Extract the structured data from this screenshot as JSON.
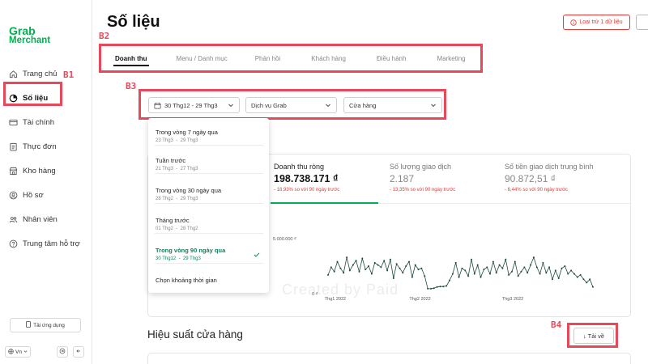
{
  "app": {
    "logo_line1": "Grab",
    "logo_line2": "Merchant",
    "brand_color": "#00b14f",
    "annotation_color": "#e8495a"
  },
  "sidebar": {
    "items": [
      {
        "label": "Trang chủ",
        "icon": "home-icon",
        "active": false
      },
      {
        "label": "Số liệu",
        "icon": "pie-chart-icon",
        "active": true
      },
      {
        "label": "Tài chính",
        "icon": "card-icon",
        "active": false
      },
      {
        "label": "Thực đơn",
        "icon": "clipboard-icon",
        "active": false
      },
      {
        "label": "Kho hàng",
        "icon": "store-icon",
        "active": false
      },
      {
        "label": "Hồ sơ",
        "icon": "profile-icon",
        "active": false
      },
      {
        "label": "Nhân viên",
        "icon": "staff-icon",
        "active": false
      },
      {
        "label": "Trung tâm hỗ trợ",
        "icon": "help-icon",
        "active": false
      }
    ],
    "download_app_label": "Tải ứng dụng",
    "language_label": "Vn"
  },
  "header": {
    "title": "Số liệu",
    "exclude_label": "Loại trừ 1 dữ liệu"
  },
  "tabs": [
    {
      "label": "Doanh thu",
      "active": true
    },
    {
      "label": "Menu / Danh mục",
      "active": false
    },
    {
      "label": "Phản hồi",
      "active": false
    },
    {
      "label": "Khách hàng",
      "active": false
    },
    {
      "label": "Điều hành",
      "active": false
    },
    {
      "label": "Marketing",
      "active": false
    }
  ],
  "annotations": {
    "b1": "B1",
    "b2": "B2",
    "b3": "B3",
    "b4": "B4"
  },
  "filters": {
    "date_range": "30 Thg12 - 29 Thg3",
    "service": "Dịch vụ Grab",
    "store": "Cửa hàng"
  },
  "date_dropdown": {
    "options": [
      {
        "label": "Trong vòng 7 ngày qua",
        "from": "23 Thg3",
        "to": "29 Thg3",
        "selected": false
      },
      {
        "label": "Tuần trước",
        "from": "21 Thg3",
        "to": "27 Thg3",
        "selected": false
      },
      {
        "label": "Trong vòng 30 ngày qua",
        "from": "28 Thg2",
        "to": "29 Thg3",
        "selected": false
      },
      {
        "label": "Tháng trước",
        "from": "01 Thg2",
        "to": "28 Thg2",
        "selected": false
      },
      {
        "label": "Trong vòng 90 ngày qua",
        "from": "30 Thg12",
        "to": "29 Thg3",
        "selected": true
      },
      {
        "label": "Chọn khoảng thời gian",
        "from": "",
        "to": "",
        "selected": false
      }
    ],
    "range_separator": "-"
  },
  "stats": [
    {
      "label": "Doanh thu ròng",
      "value": "198.738.171 ₫",
      "change": "- 18,93% so với 90 ngày trước"
    },
    {
      "label": "Số lượng giao dịch",
      "value": "2.187",
      "change": "- 13,35% so với 90 ngày trước"
    },
    {
      "label": "Số tiền giao dịch trung bình",
      "value": "90.872,51 ₫",
      "change": "- 6,44% so với 90 ngày trước"
    }
  ],
  "chart_data": {
    "type": "line",
    "title": "",
    "xlabel": "",
    "ylabel": "",
    "x_ticks": [
      "Thg1 2022",
      "Thg2 2022",
      "Thg3 2022"
    ],
    "y_ticks": [
      "5.000.000 ₫",
      "0 ₫"
    ],
    "ylim": [
      0,
      5000000
    ],
    "grid": false,
    "line_color": "#1d4a3f",
    "series": [
      {
        "name": "",
        "values": [
          1700000,
          2400000,
          2000000,
          2900000,
          2300000,
          1900000,
          3300000,
          2100000,
          2600000,
          3000000,
          2000000,
          3200000,
          2200000,
          2500000,
          1800000,
          2800000,
          2600000,
          2400000,
          3000000,
          2100000,
          3100000,
          1400000,
          2700000,
          2300000,
          1900000,
          2500000,
          2900000,
          1500000,
          2600000,
          2200000,
          2300000,
          1600000,
          450000,
          450000,
          500000,
          600000,
          650000,
          650000,
          700000,
          1200000,
          1800000,
          2800000,
          1500000,
          2300000,
          2100000,
          1600000,
          3100000,
          1800000,
          2600000,
          1500000,
          2200000,
          2400000,
          1800000,
          2900000,
          1900000,
          2600000,
          2300000,
          3100000,
          1700000,
          2000000,
          2900000,
          1600000,
          2000000,
          2400000,
          1900000,
          2600000,
          3300000,
          2400000,
          1800000,
          2800000,
          1900000,
          2400000,
          1300000,
          2100000,
          1400000,
          2300000,
          2500000,
          1800000,
          2100000,
          1800000,
          1500000,
          1700000,
          1300000,
          1000000,
          1300000,
          600000
        ]
      }
    ]
  },
  "watermark": "Created by Paid",
  "section": {
    "title": "Hiệu suất cửa hàng",
    "download_label": "↓ Tải về"
  }
}
